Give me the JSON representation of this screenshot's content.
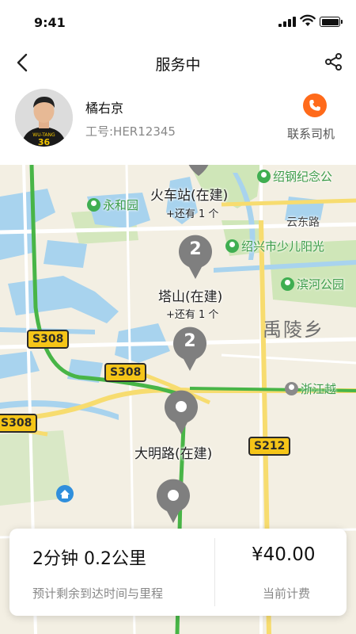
{
  "status_bar": {
    "time": "9:41"
  },
  "nav": {
    "title": "服务中"
  },
  "driver": {
    "name": "橘右京",
    "employee_id": "工号:HER12345",
    "call_label": "联系司机",
    "avatar_shirt_text": "WU-TANG",
    "call_color": "#ff6a1a"
  },
  "map": {
    "labels": {
      "station_train": "火车站(在建)",
      "station_train_more": "+还有 1 个",
      "station_tashan": "塔山(在建)",
      "station_tashan_more": "+还有 1 个",
      "station_daming": "大明路(在建)",
      "area_yuling": "禹陵乡",
      "road_yunDong": "云东路"
    },
    "pois": {
      "yonghe": "永和园",
      "shaogang": "绍钢纪念公",
      "shaoxing_youth": "绍兴市少儿阳光",
      "binhe": "滨河公园",
      "zhewang": "浙江越"
    },
    "road_shields": {
      "s308_a": "S308",
      "s308_b": "S308",
      "s308_c": "S308",
      "s212": "S212"
    },
    "clusters": {
      "tashan_count": "2",
      "mid_count": "2"
    }
  },
  "trip": {
    "eta_text": "2分钟  0.2公里",
    "eta_caption": "预计剩余到达时间与里程",
    "fee_text": "¥40.00",
    "fee_caption": "当前计费"
  }
}
